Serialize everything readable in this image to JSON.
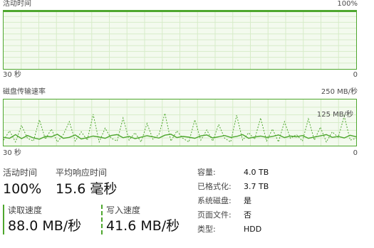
{
  "activity_graph": {
    "title": "活动时间",
    "max_label": "100%",
    "time_label": "30 秒",
    "min_label": "0"
  },
  "transfer_graph": {
    "title": "磁盘传输速率",
    "max_label": "250 MB/秒",
    "mid_label": "125 MB/秒",
    "time_label": "30 秒",
    "min_label": "0",
    "max_value_mbps": 250,
    "read_series_mbps": [
      45,
      40,
      60,
      38,
      55,
      42,
      35,
      50,
      48,
      62,
      40,
      45,
      58,
      36,
      44,
      52,
      47,
      40,
      55,
      60,
      43,
      50,
      38,
      46,
      54,
      48,
      41,
      57,
      62,
      44,
      50,
      46,
      40,
      53,
      58,
      42,
      48,
      55,
      45,
      50,
      60,
      40,
      47,
      52,
      45,
      50,
      58,
      44,
      52,
      48,
      55,
      40,
      47,
      53,
      60,
      45,
      50,
      42,
      56,
      48
    ],
    "write_series_mbps": [
      30,
      80,
      20,
      110,
      40,
      25,
      140,
      35,
      90,
      20,
      60,
      130,
      25,
      75,
      30,
      170,
      20,
      95,
      40,
      25,
      150,
      30,
      70,
      20,
      120,
      35,
      60,
      175,
      25,
      80,
      40,
      20,
      140,
      30,
      85,
      25,
      115,
      40,
      20,
      165,
      30,
      70,
      35,
      150,
      25,
      90,
      20,
      130,
      40,
      60,
      25,
      145,
      30,
      100,
      20,
      75,
      45,
      160,
      30,
      40
    ]
  },
  "stats": {
    "active_time": {
      "label": "活动时间",
      "value": "100%"
    },
    "avg_response": {
      "label": "平均响应时间",
      "value": "15.6 毫秒"
    },
    "read_speed": {
      "label": "读取速度",
      "value": "88.0 MB/秒"
    },
    "write_speed": {
      "label": "写入速度",
      "value": "41.6 MB/秒"
    }
  },
  "properties": [
    {
      "label": "容量:",
      "value": "4.0 TB"
    },
    {
      "label": "已格式化:",
      "value": "3.7 TB"
    },
    {
      "label": "系统磁盘:",
      "value": "是"
    },
    {
      "label": "页面文件:",
      "value": "否"
    },
    {
      "label": "类型:",
      "value": "HDD"
    }
  ],
  "colors": {
    "accent": "#4ea72e",
    "grid": "#d7ecc9",
    "fill": "#f3faee"
  }
}
